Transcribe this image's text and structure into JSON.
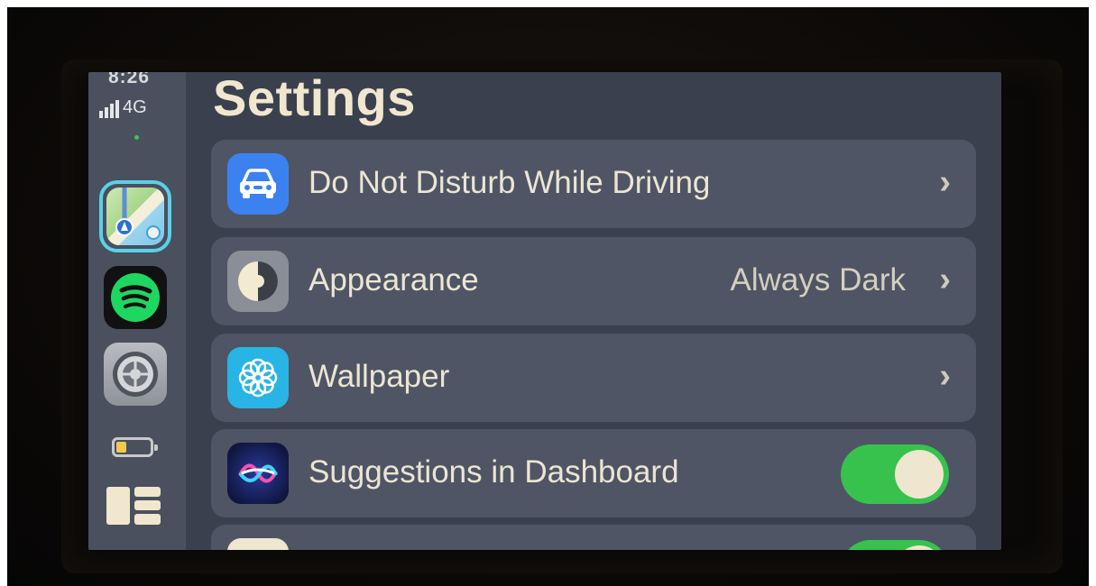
{
  "status": {
    "time": "8:26",
    "network": "4G"
  },
  "sidebar": {
    "apps": [
      {
        "name": "Maps",
        "icon": "maps-icon",
        "selected": true
      },
      {
        "name": "Spotify",
        "icon": "spotify-icon",
        "selected": false
      },
      {
        "name": "Settings",
        "icon": "settings-gear-icon",
        "selected": false
      }
    ],
    "battery_level": 0.3,
    "dashboard_icon": "dashboard-grid-icon"
  },
  "page": {
    "title": "Settings"
  },
  "settings": {
    "rows": [
      {
        "label": "Do Not Disturb While Driving",
        "icon": "car-icon",
        "icon_color": "#3b82f0",
        "value": "",
        "control": "chevron"
      },
      {
        "label": "Appearance",
        "icon": "appearance-icon",
        "icon_color": "#8a8e96",
        "value": "Always Dark",
        "control": "chevron"
      },
      {
        "label": "Wallpaper",
        "icon": "wallpaper-flower-icon",
        "icon_color": "#29b4e6",
        "value": "",
        "control": "chevron"
      },
      {
        "label": "Suggestions in Dashboard",
        "icon": "siri-icon",
        "icon_color": "#1f2a6e",
        "value": "",
        "control": "toggle",
        "on": true
      }
    ],
    "chevron_glyph": "›"
  },
  "colors": {
    "toggle_on": "#37c24e",
    "background": "#3a404e",
    "row": "#4f5564",
    "text": "#ece5d3"
  }
}
